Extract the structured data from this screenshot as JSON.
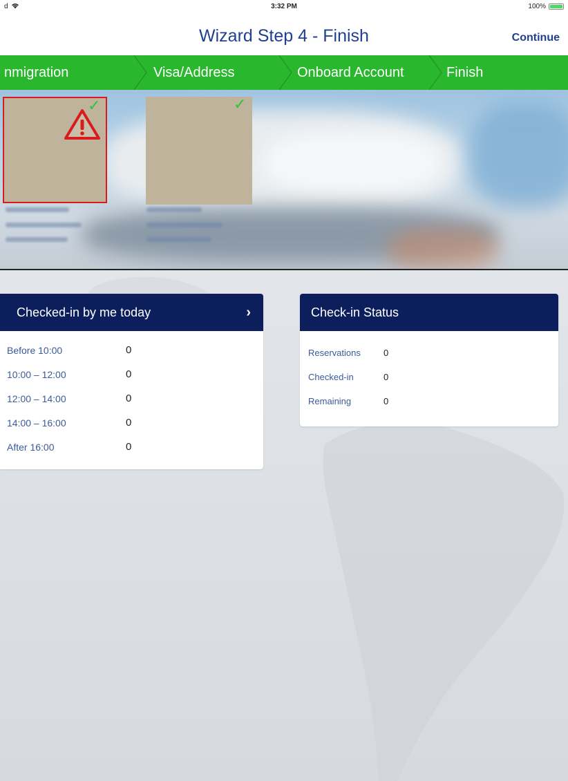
{
  "status_bar": {
    "carrier": "d",
    "wifi_icon": "wifi-icon",
    "time": "3:32 PM",
    "battery_percent": "100%",
    "battery_level": 1.0
  },
  "nav": {
    "title": "Wizard Step 4 - Finish",
    "continue_label": "Continue"
  },
  "steps": [
    {
      "label": "nmigration"
    },
    {
      "label": "Visa/Address"
    },
    {
      "label": "Onboard Account"
    },
    {
      "label": "Finish"
    }
  ],
  "guests": [
    {
      "status": "warning",
      "warning_icon": "warning-triangle-icon",
      "check_icon": "checkmark-icon"
    },
    {
      "status": "ok",
      "check_icon": "checkmark-icon"
    }
  ],
  "checked_in_panel": {
    "title": "Checked-in by me today",
    "arrow_icon": "chevron-right-icon",
    "rows": [
      {
        "label": "Before 10:00",
        "value": "0"
      },
      {
        "label": "10:00 – 12:00",
        "value": "0"
      },
      {
        "label": "12:00 – 14:00",
        "value": "0"
      },
      {
        "label": "14:00 – 16:00",
        "value": "0"
      },
      {
        "label": "After 16:00",
        "value": "0"
      }
    ]
  },
  "status_panel": {
    "title": "Check-in Status",
    "rows": [
      {
        "label": "Reservations",
        "value": "0"
      },
      {
        "label": "Checked-in",
        "value": "0"
      },
      {
        "label": "Remaining",
        "value": "0"
      }
    ]
  },
  "colors": {
    "step_bar": "#29b72e",
    "panel_header": "#0c1e5c",
    "title_blue": "#1f3f8f",
    "warning_red": "#d81b1b",
    "check_green": "#2fc534"
  }
}
